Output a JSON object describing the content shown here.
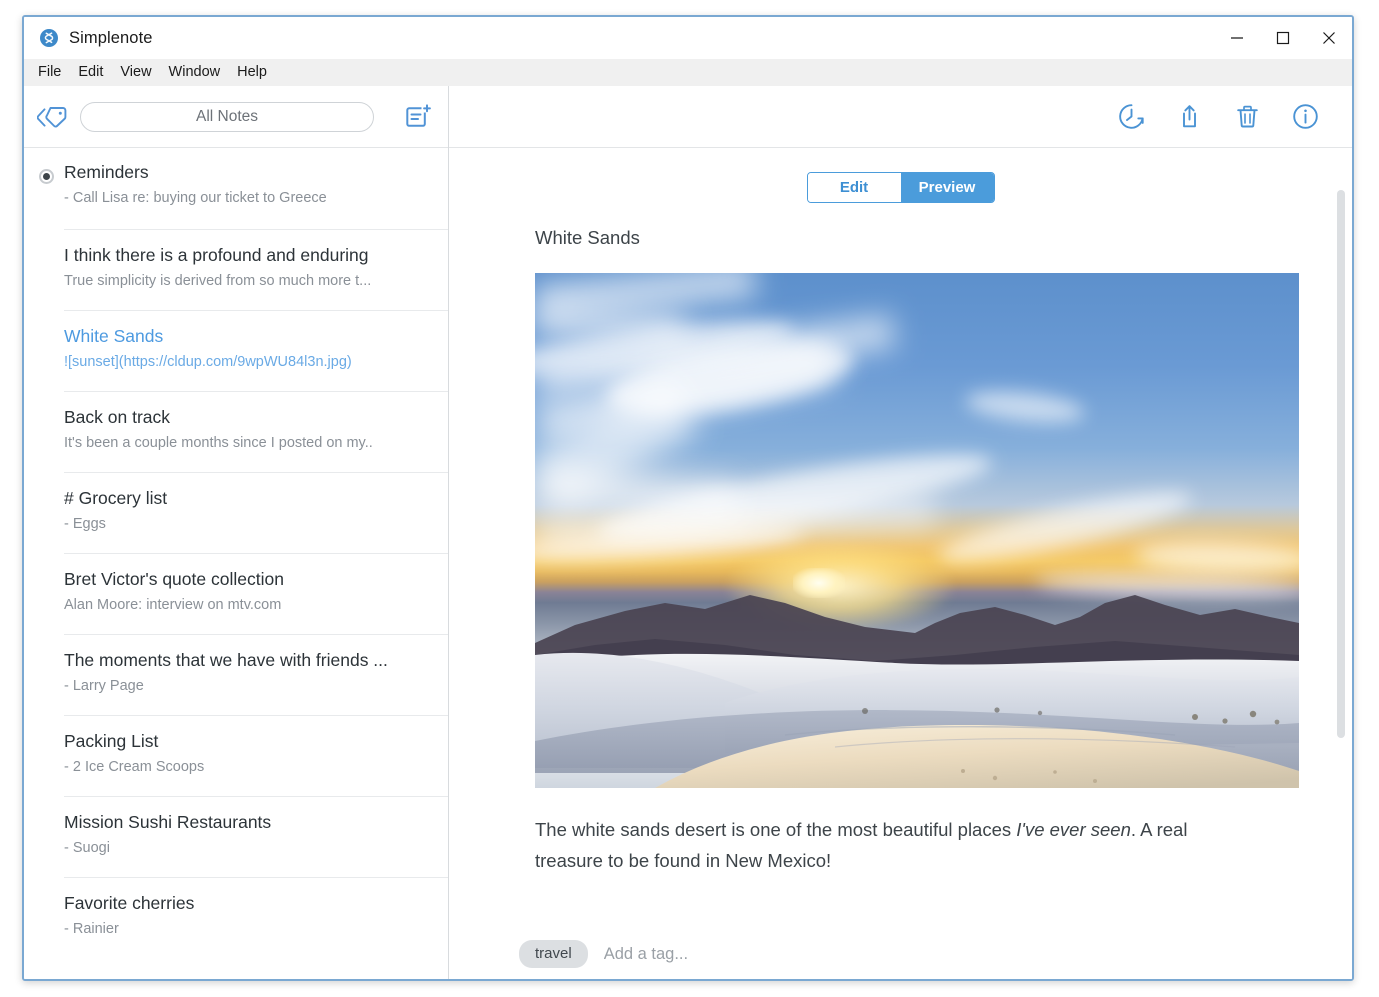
{
  "window": {
    "app_title": "Simplenote",
    "logo_icon": "simplenote-logo-icon",
    "controls": {
      "minimize": "minimize-icon",
      "maximize": "maximize-icon",
      "close": "close-icon"
    }
  },
  "menubar": {
    "items": [
      {
        "label": "File"
      },
      {
        "label": "Edit"
      },
      {
        "label": "View"
      },
      {
        "label": "Window"
      },
      {
        "label": "Help"
      }
    ]
  },
  "left_pane": {
    "toolbar": {
      "tags_icon": "tags-icon",
      "search_value": "",
      "search_placeholder": "All Notes",
      "new_note_icon": "new-note-icon"
    },
    "notes": [
      {
        "title": "Reminders",
        "preview": "- Call Lisa re: buying our ticket to Greece",
        "pinned": true,
        "selected": false
      },
      {
        "title": "I think there is a profound and enduring",
        "preview": "True simplicity is derived from so much more t...",
        "pinned": false,
        "selected": false
      },
      {
        "title": "White Sands",
        "preview": "![sunset](https://cldup.com/9wpWU84l3n.jpg)",
        "pinned": false,
        "selected": true
      },
      {
        "title": "Back on track",
        "preview": "It's been a couple months since I posted on my..",
        "pinned": false,
        "selected": false
      },
      {
        "title": "# Grocery list",
        "preview": "- Eggs",
        "pinned": false,
        "selected": false
      },
      {
        "title": "Bret Victor's quote collection",
        "preview": "Alan Moore: interview on mtv.com",
        "pinned": false,
        "selected": false
      },
      {
        "title": "The moments that we have with friends ...",
        "preview": "- Larry Page",
        "pinned": false,
        "selected": false
      },
      {
        "title": "Packing List",
        "preview": "- 2 Ice Cream Scoops",
        "pinned": false,
        "selected": false
      },
      {
        "title": "Mission Sushi Restaurants",
        "preview": "- Suogi",
        "pinned": false,
        "selected": false
      },
      {
        "title": "Favorite cherries",
        "preview": "- Rainier",
        "pinned": false,
        "selected": false
      }
    ]
  },
  "right_pane": {
    "toolbar_icons": [
      {
        "name": "history-icon"
      },
      {
        "name": "share-icon"
      },
      {
        "name": "trash-icon"
      },
      {
        "name": "info-icon"
      }
    ],
    "mode_toggle": {
      "edit_label": "Edit",
      "preview_label": "Preview",
      "active": "Preview"
    },
    "note": {
      "title": "White Sands",
      "image_alt": "sunset",
      "text_before_italic": "The white sands desert is one of the most beautiful places ",
      "text_italic": "I've ever seen",
      "text_after_italic": ". A real treasure to be found in New Mexico!"
    },
    "tags": {
      "chips": [
        {
          "label": "travel"
        }
      ],
      "add_placeholder": "Add a tag...",
      "add_value": ""
    }
  },
  "colors": {
    "accent": "#4b9cdb",
    "selected_note": "#4d9ae0",
    "text": "#3d4449",
    "muted": "#8a9097"
  }
}
